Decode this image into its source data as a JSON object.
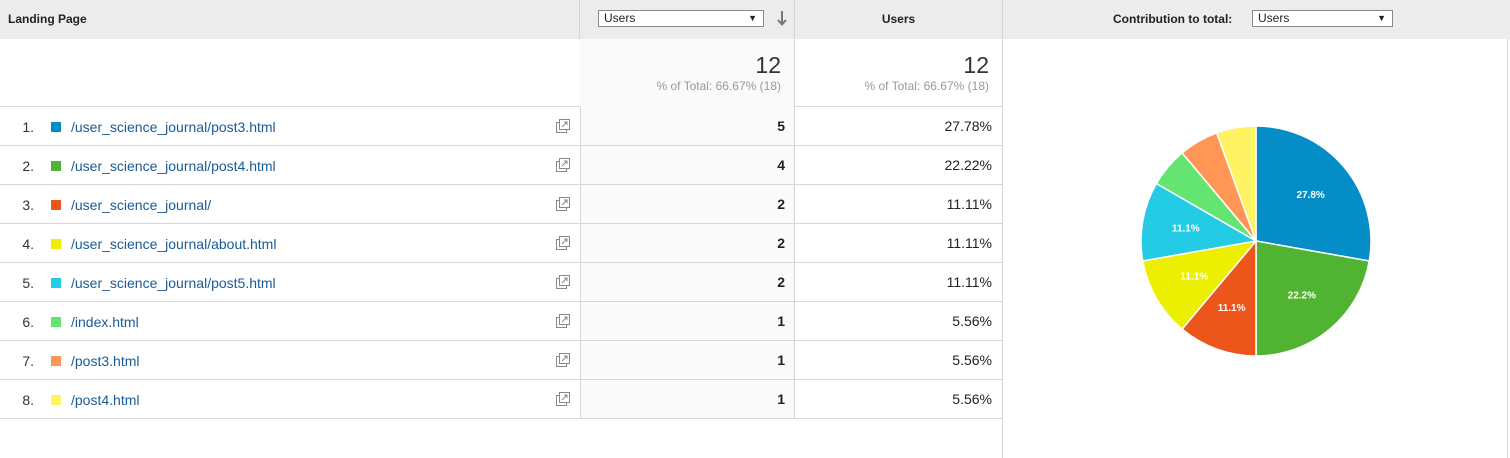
{
  "header": {
    "landing_page": "Landing Page",
    "metric_select": "Users",
    "users": "Users",
    "contribution_label": "Contribution to total:",
    "contribution_select": "Users"
  },
  "totals": {
    "col1_value": "12",
    "col1_sub": "% of Total: 66.67% (18)",
    "col2_value": "12",
    "col2_sub": "% of Total: 66.67% (18)"
  },
  "rows": [
    {
      "num": "1.",
      "page": "/user_science_journal/post3.html",
      "users": "5",
      "pct": "27.78%",
      "color": "#058dc7"
    },
    {
      "num": "2.",
      "page": "/user_science_journal/post4.html",
      "users": "4",
      "pct": "22.22%",
      "color": "#50b432"
    },
    {
      "num": "3.",
      "page": "/user_science_journal/",
      "users": "2",
      "pct": "11.11%",
      "color": "#ed561b"
    },
    {
      "num": "4.",
      "page": "/user_science_journal/about.html",
      "users": "2",
      "pct": "11.11%",
      "color": "#edef00"
    },
    {
      "num": "5.",
      "page": "/user_science_journal/post5.html",
      "users": "2",
      "pct": "11.11%",
      "color": "#24cbe5"
    },
    {
      "num": "6.",
      "page": "/index.html",
      "users": "1",
      "pct": "5.56%",
      "color": "#64e572"
    },
    {
      "num": "7.",
      "page": "/post3.html",
      "users": "1",
      "pct": "5.56%",
      "color": "#ff9655"
    },
    {
      "num": "8.",
      "page": "/post4.html",
      "users": "1",
      "pct": "5.56%",
      "color": "#fff263"
    }
  ],
  "chart_data": {
    "type": "pie",
    "categories": [
      "/user_science_journal/post3.html",
      "/user_science_journal/post4.html",
      "/user_science_journal/",
      "/user_science_journal/about.html",
      "/user_science_journal/post5.html",
      "/index.html",
      "/post3.html",
      "/post4.html"
    ],
    "values": [
      5,
      4,
      2,
      2,
      2,
      1,
      1,
      1
    ],
    "labels": [
      "27.8%",
      "22.2%",
      "11.1%",
      "11.1%",
      "11.1%",
      "",
      "",
      ""
    ],
    "colors": [
      "#058dc7",
      "#50b432",
      "#ed561b",
      "#edef00",
      "#24cbe5",
      "#64e572",
      "#ff9655",
      "#fff263"
    ]
  }
}
